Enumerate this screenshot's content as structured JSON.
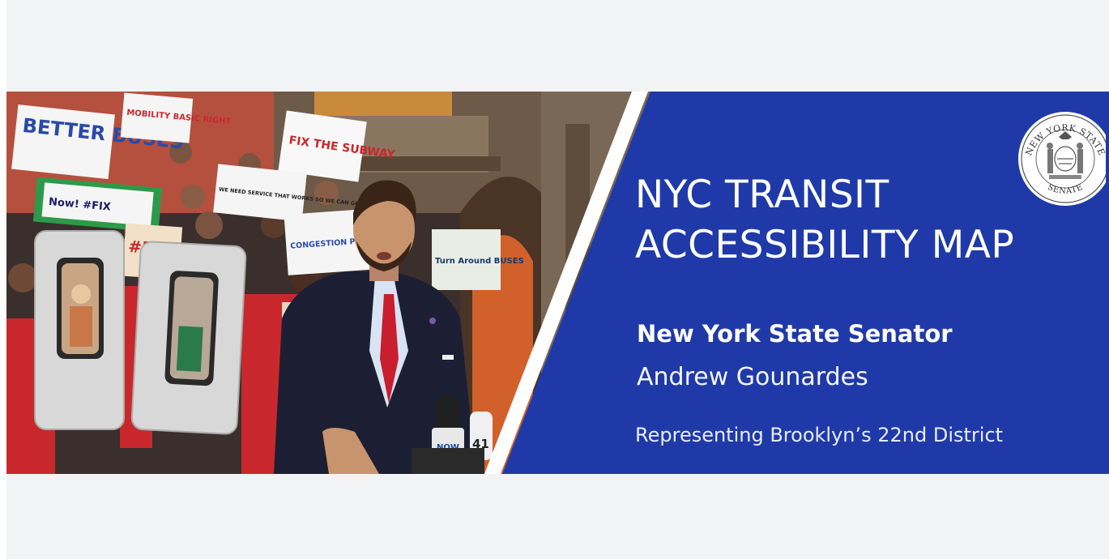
{
  "banner": {
    "title_line_1": "NYC TRANSIT",
    "title_line_2": "ACCESSIBILITY MAP",
    "senator_role": "New York State Senator",
    "senator_name": "Andrew Gounardes",
    "district": "Representing Brooklyn’s 22nd District",
    "colors": {
      "panel_blue": "#1f3aa8",
      "stripe": "#ffffff",
      "text": "#ffffff",
      "page_background": "#f2f3f5"
    }
  },
  "seal": {
    "top_text": "NEW YORK STATE",
    "bottom_text": "SENATE"
  },
  "photo": {
    "signs": {
      "better_buses": "BETTER BUSES",
      "fix_subway": "FIX THE SUBWAY",
      "mobility": "MOBILITY BASIC RIGHT",
      "congestion": "CONGESTION PRICING NOW",
      "turn_around": "Turn Around BUSES",
      "fix_hashtag": "#FIX",
      "need_service": "WE NEED SERVICE THAT WORKS SO WE CAN GO",
      "now_fix": "Now! #FIX",
      "mic": "NOW",
      "mic_number": "41"
    }
  }
}
